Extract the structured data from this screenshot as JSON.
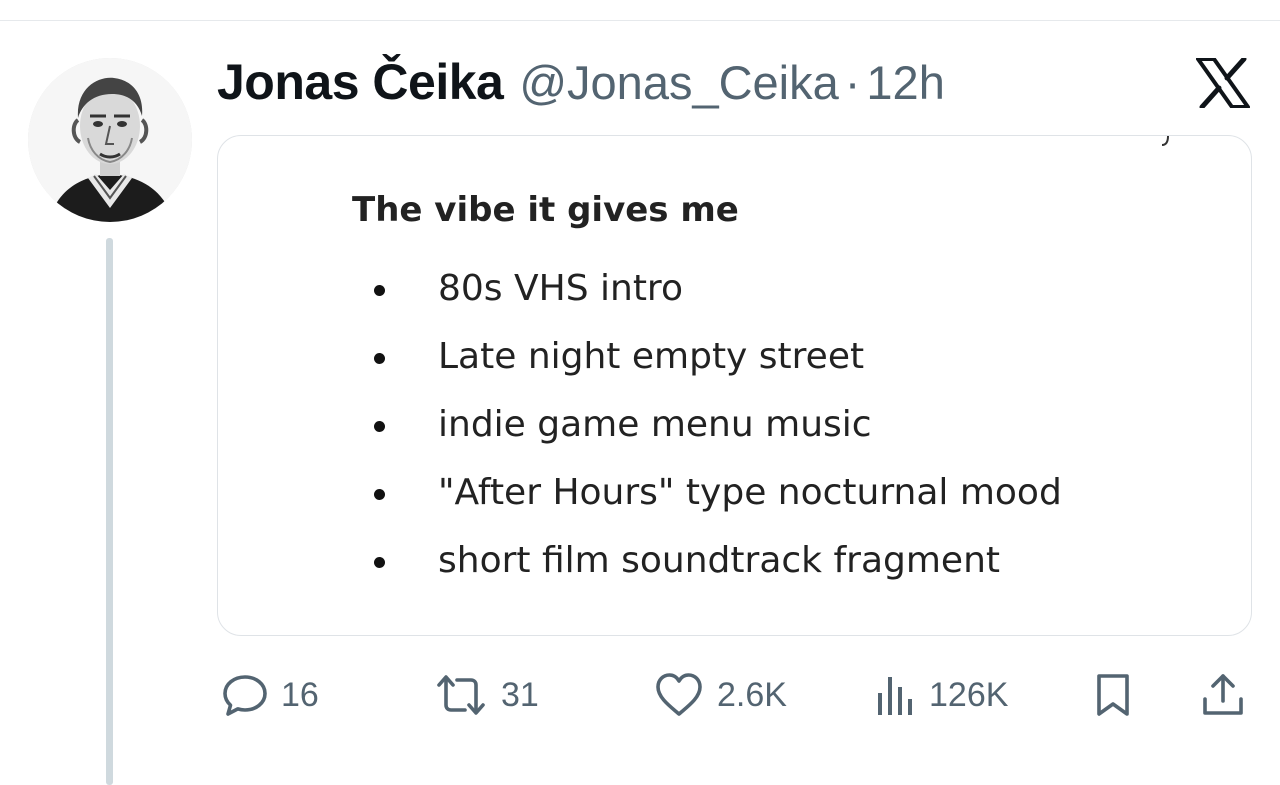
{
  "tweet": {
    "author_name": "Jonas Čeika",
    "handle": "@Jonas_Ceika",
    "separator": "·",
    "time": "12h",
    "avatar_icon": "portrait-engraving-avatar"
  },
  "media_note": {
    "title": "The vibe it gives me",
    "items": [
      "80s VHS intro",
      "Late night empty street",
      "indie game menu music",
      "\"After Hours\" type nocturnal mood",
      "short film soundtrack fragment"
    ]
  },
  "actions": {
    "replies": "16",
    "reposts": "31",
    "likes": "2.6K",
    "views": "126K"
  },
  "icons": {
    "platform": "x-logo-icon",
    "reply": "comment-bubble-icon",
    "repost": "repost-arrows-icon",
    "like": "heart-icon",
    "views": "bar-chart-icon",
    "bookmark": "bookmark-icon",
    "share": "share-icon"
  },
  "colors": {
    "text_primary": "#0f1419",
    "text_secondary": "#536471",
    "border": "#dfe3e7",
    "thread_line": "#cfd9de"
  }
}
